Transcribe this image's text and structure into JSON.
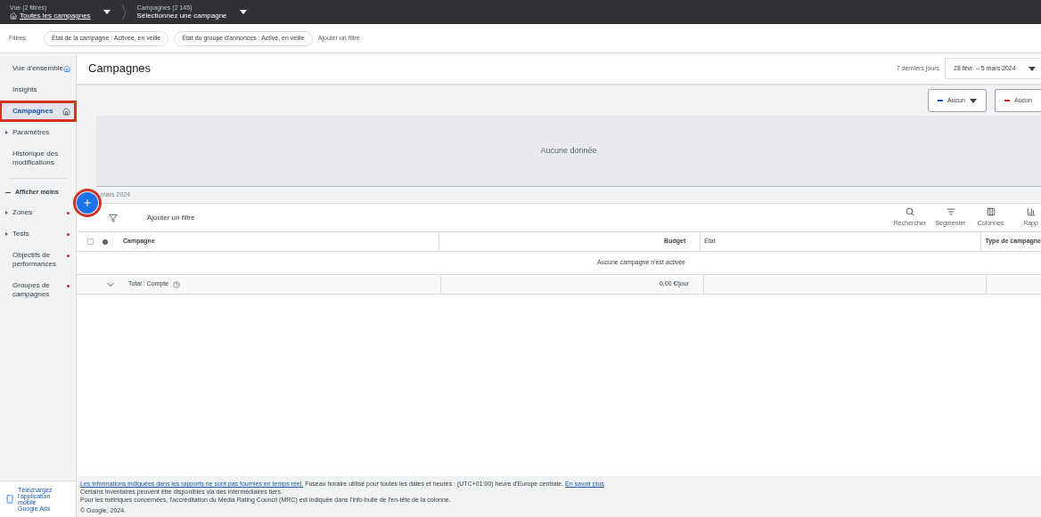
{
  "top_bar": {
    "view_label": "Vue (2 filtres)",
    "view_value": "Toutes les campagnes",
    "campaign_label": "Campagnes (2 145)",
    "campaign_value": "Sélectionnez une campagne"
  },
  "filters": {
    "label": "Filtres",
    "chips": [
      "État de la campagne : Activée, en veille",
      "État du groupe d'annonces : Activé, en veille"
    ],
    "add": "Ajouter un filtre"
  },
  "sidebar": {
    "items": [
      {
        "label": "Vue d'ensemble",
        "kind": "home",
        "selected": false,
        "alert": false,
        "highlighted": false
      },
      {
        "label": "Insights",
        "kind": "plain",
        "selected": false,
        "alert": false,
        "highlighted": false
      },
      {
        "label": "Campagnes",
        "kind": "home",
        "selected": true,
        "alert": false,
        "highlighted": true
      },
      {
        "label": "Paramètres",
        "kind": "expandable",
        "selected": false,
        "alert": false,
        "highlighted": false
      },
      {
        "label": "Historique des modifications",
        "kind": "plain",
        "selected": false,
        "alert": false,
        "highlighted": false
      }
    ],
    "toggle": "Afficher moins",
    "more_items": [
      {
        "label": "Zones",
        "kind": "expandable",
        "selected": false,
        "alert": true,
        "highlighted": false
      },
      {
        "label": "Tests",
        "kind": "expandable",
        "selected": false,
        "alert": true,
        "highlighted": false
      },
      {
        "label": "Objectifs de performances",
        "kind": "plain",
        "selected": false,
        "alert": true,
        "highlighted": false
      },
      {
        "label": "Groupes de campagnes",
        "kind": "plain",
        "selected": false,
        "alert": true,
        "highlighted": false
      }
    ],
    "app_promo": "Téléchargez l'application mobile Google Ads"
  },
  "header": {
    "title": "Campagnes",
    "range_label": "7 derniers jours",
    "date_range": "28 févr. – 5 mars 2024"
  },
  "chart": {
    "metrics": [
      {
        "label": "Aucun",
        "color": "#1a56b0",
        "has_caret": true
      },
      {
        "label": "Aucun",
        "color": "#c5221f",
        "has_caret": false
      }
    ],
    "empty_text": "Aucune donnée",
    "axis_label": "mars 2024"
  },
  "fab": {
    "highlighted": true
  },
  "table": {
    "filter_placeholder": "Ajouter un filtre",
    "tools": [
      "Rechercher",
      "Segmenter",
      "Colonnes",
      "Rapp"
    ],
    "select_all_checked": false,
    "columns": [
      "Campagne",
      "Budget",
      "État",
      "Type de campagne"
    ],
    "empty_text": "Aucune campagne n'est activée",
    "total": {
      "label": "Total : Compte",
      "budget": "0,00 €/jour"
    }
  },
  "footer": {
    "link1": "Les informations indiquées dans les rapports ne sont pas fournies en temps réel.",
    "text1": "Fuseau horaire utilisé pour toutes les dates et heures : (UTC+01:00) heure d'Europe centrale.",
    "link2": "En savoir plus",
    "lines": [
      "Certains inventaires peuvent être disponibles via des intermédiaires tiers.",
      "Pour les métriques concernées, l'accréditation du Media Rating Council (MRC) est indiquée dans l'info-bulle de l'en-tête de la colonne."
    ],
    "copyright": "© Google, 2024."
  }
}
